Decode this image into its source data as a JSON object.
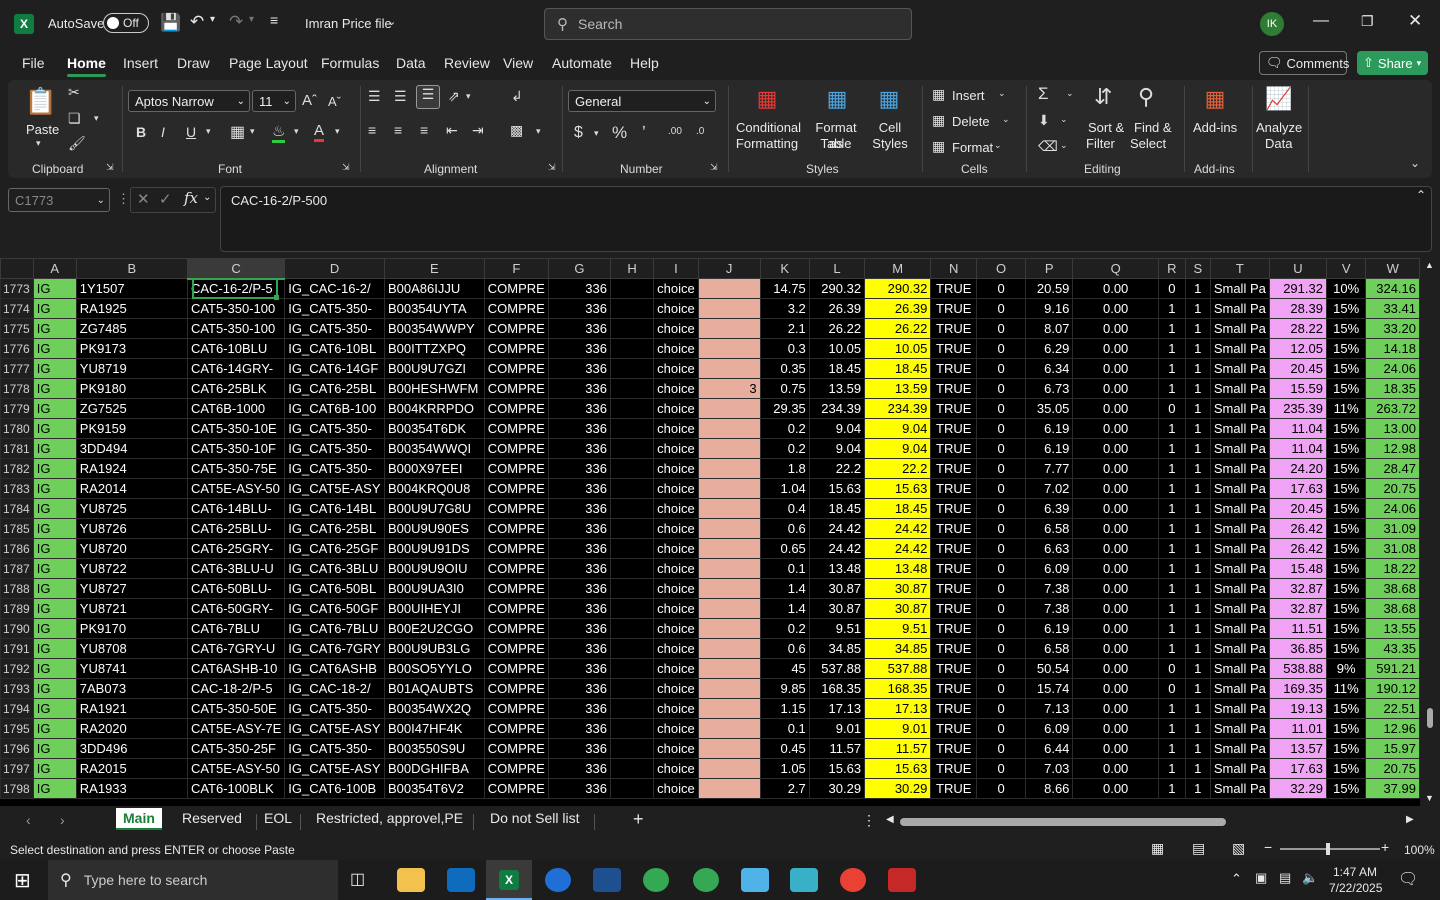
{
  "titlebar": {
    "autosave_label": "AutoSave",
    "autosave_state": "Off",
    "file_name": "Imran Price file",
    "search_placeholder": "Search",
    "avatar_initials": "IK"
  },
  "tabs": [
    "File",
    "Home",
    "Insert",
    "Draw",
    "Page Layout",
    "Formulas",
    "Data",
    "Review",
    "View",
    "Automate",
    "Help"
  ],
  "active_tab": "Home",
  "comments_label": "Comments",
  "share_label": "Share",
  "ribbon": {
    "clipboard": {
      "paste": "Paste",
      "group": "Clipboard"
    },
    "font": {
      "name": "Aptos Narrow",
      "size": "11",
      "group": "Font"
    },
    "alignment": {
      "group": "Alignment"
    },
    "number": {
      "format": "General",
      "group": "Number"
    },
    "styles": {
      "conditional": "Conditional",
      "formatting": "Formatting",
      "format_as": "Format as",
      "table": "Table",
      "cell": "Cell",
      "cell_styles": "Styles",
      "group": "Styles"
    },
    "cells": {
      "insert": "Insert",
      "delete": "Delete",
      "format": "Format",
      "group": "Cells"
    },
    "editing": {
      "sort": "Sort &",
      "filter": "Filter",
      "find": "Find &",
      "select": "Select",
      "group": "Editing"
    },
    "addins": {
      "addins": "Add-ins",
      "group": "Add-ins"
    },
    "analyze": {
      "line1": "Analyze",
      "line2": "Data"
    }
  },
  "formula_bar": {
    "name_box": "C1773",
    "formula": "CAC-16-2/P-500"
  },
  "columns": [
    "A",
    "B",
    "C",
    "D",
    "E",
    "F",
    "G",
    "H",
    "I",
    "J",
    "K",
    "L",
    "M",
    "N",
    "O",
    "P",
    "Q",
    "R",
    "S",
    "T",
    "U",
    "V",
    "W"
  ],
  "rows": [
    {
      "n": "1773",
      "a": "IG",
      "b": "1Y1507",
      "c": "CAC-16-2/P-5",
      "d": "IG_CAC-16-2/",
      "e": "B00A86IJJU",
      "f": "COMPRE",
      "g": "336",
      "i": "choice",
      "j": "",
      "k": "14.75",
      "l": "290.32",
      "m": "290.32",
      "o": "0",
      "p": "20.59",
      "q": "0.00",
      "r": "0",
      "s": "1",
      "t": "Small Pa",
      "u": "291.32",
      "v": "10%",
      "w": "324.16"
    },
    {
      "n": "1774",
      "a": "IG",
      "b": "RA1925",
      "c": "CAT5-350-100",
      "d": "IG_CAT5-350-",
      "e": "B00354UYTA",
      "f": "COMPRE",
      "g": "336",
      "i": "choice",
      "j": "",
      "k": "3.2",
      "l": "26.39",
      "m": "26.39",
      "o": "0",
      "p": "9.16",
      "q": "0.00",
      "r": "1",
      "s": "1",
      "t": "Small Pa",
      "u": "28.39",
      "v": "15%",
      "w": "33.41"
    },
    {
      "n": "1775",
      "a": "IG",
      "b": "ZG7485",
      "c": "CAT5-350-100",
      "d": "IG_CAT5-350-",
      "e": "B00354WWPY",
      "f": "COMPRE",
      "g": "336",
      "i": "choice",
      "j": "",
      "k": "2.1",
      "l": "26.22",
      "m": "26.22",
      "o": "0",
      "p": "8.07",
      "q": "0.00",
      "r": "1",
      "s": "1",
      "t": "Small Pa",
      "u": "28.22",
      "v": "15%",
      "w": "33.20"
    },
    {
      "n": "1776",
      "a": "IG",
      "b": "PK9173",
      "c": "CAT6-10BLU",
      "d": "IG_CAT6-10BL",
      "e": "B00ITTZXPQ",
      "f": "COMPRE",
      "g": "336",
      "i": "choice",
      "j": "",
      "k": "0.3",
      "l": "10.05",
      "m": "10.05",
      "o": "0",
      "p": "6.29",
      "q": "0.00",
      "r": "1",
      "s": "1",
      "t": "Small Pa",
      "u": "12.05",
      "v": "15%",
      "w": "14.18"
    },
    {
      "n": "1777",
      "a": "IG",
      "b": "YU8719",
      "c": "CAT6-14GRY-",
      "d": "IG_CAT6-14GF",
      "e": "B00U9U7GZI",
      "f": "COMPRE",
      "g": "336",
      "i": "choice",
      "j": "",
      "k": "0.35",
      "l": "18.45",
      "m": "18.45",
      "o": "0",
      "p": "6.34",
      "q": "0.00",
      "r": "1",
      "s": "1",
      "t": "Small Pa",
      "u": "20.45",
      "v": "15%",
      "w": "24.06"
    },
    {
      "n": "1778",
      "a": "IG",
      "b": "PK9180",
      "c": "CAT6-25BLK",
      "d": "IG_CAT6-25BL",
      "e": "B00HESHWFM",
      "f": "COMPRE",
      "g": "336",
      "i": "choice",
      "j": "3",
      "k": "0.75",
      "l": "13.59",
      "m": "13.59",
      "o": "0",
      "p": "6.73",
      "q": "0.00",
      "r": "1",
      "s": "1",
      "t": "Small Pa",
      "u": "15.59",
      "v": "15%",
      "w": "18.35"
    },
    {
      "n": "1779",
      "a": "IG",
      "b": "ZG7525",
      "c": "CAT6B-1000",
      "d": "IG_CAT6B-100",
      "e": "B004KRRPDO",
      "f": "COMPRE",
      "g": "336",
      "i": "choice",
      "j": "",
      "k": "29.35",
      "l": "234.39",
      "m": "234.39",
      "o": "0",
      "p": "35.05",
      "q": "0.00",
      "r": "0",
      "s": "1",
      "t": "Small Pa",
      "u": "235.39",
      "v": "11%",
      "w": "263.72"
    },
    {
      "n": "1780",
      "a": "IG",
      "b": "PK9159",
      "c": "CAT5-350-10E",
      "d": "IG_CAT5-350-",
      "e": "B00354T6DK",
      "f": "COMPRE",
      "g": "336",
      "i": "choice",
      "j": "",
      "k": "0.2",
      "l": "9.04",
      "m": "9.04",
      "o": "0",
      "p": "6.19",
      "q": "0.00",
      "r": "1",
      "s": "1",
      "t": "Small Pa",
      "u": "11.04",
      "v": "15%",
      "w": "13.00"
    },
    {
      "n": "1781",
      "a": "IG",
      "b": "3DD494",
      "c": "CAT5-350-10F",
      "d": "IG_CAT5-350-",
      "e": "B00354WWQI",
      "f": "COMPRE",
      "g": "336",
      "i": "choice",
      "j": "",
      "k": "0.2",
      "l": "9.04",
      "m": "9.04",
      "o": "0",
      "p": "6.19",
      "q": "0.00",
      "r": "1",
      "s": "1",
      "t": "Small Pa",
      "u": "11.04",
      "v": "15%",
      "w": "12.98"
    },
    {
      "n": "1782",
      "a": "IG",
      "b": "RA1924",
      "c": "CAT5-350-75E",
      "d": "IG_CAT5-350-",
      "e": "B000X97EEI",
      "f": "COMPRE",
      "g": "336",
      "i": "choice",
      "j": "",
      "k": "1.8",
      "l": "22.2",
      "m": "22.2",
      "o": "0",
      "p": "7.77",
      "q": "0.00",
      "r": "1",
      "s": "1",
      "t": "Small Pa",
      "u": "24.20",
      "v": "15%",
      "w": "28.47"
    },
    {
      "n": "1783",
      "a": "IG",
      "b": "RA2014",
      "c": "CAT5E-ASY-50",
      "d": "IG_CAT5E-ASY",
      "e": "B004KRQ0U8",
      "f": "COMPRE",
      "g": "336",
      "i": "choice",
      "j": "",
      "k": "1.04",
      "l": "15.63",
      "m": "15.63",
      "o": "0",
      "p": "7.02",
      "q": "0.00",
      "r": "1",
      "s": "1",
      "t": "Small Pa",
      "u": "17.63",
      "v": "15%",
      "w": "20.75"
    },
    {
      "n": "1784",
      "a": "IG",
      "b": "YU8725",
      "c": "CAT6-14BLU-",
      "d": "IG_CAT6-14BL",
      "e": "B00U9U7G8U",
      "f": "COMPRE",
      "g": "336",
      "i": "choice",
      "j": "",
      "k": "0.4",
      "l": "18.45",
      "m": "18.45",
      "o": "0",
      "p": "6.39",
      "q": "0.00",
      "r": "1",
      "s": "1",
      "t": "Small Pa",
      "u": "20.45",
      "v": "15%",
      "w": "24.06"
    },
    {
      "n": "1785",
      "a": "IG",
      "b": "YU8726",
      "c": "CAT6-25BLU-",
      "d": "IG_CAT6-25BL",
      "e": "B00U9U90ES",
      "f": "COMPRE",
      "g": "336",
      "i": "choice",
      "j": "",
      "k": "0.6",
      "l": "24.42",
      "m": "24.42",
      "o": "0",
      "p": "6.58",
      "q": "0.00",
      "r": "1",
      "s": "1",
      "t": "Small Pa",
      "u": "26.42",
      "v": "15%",
      "w": "31.09"
    },
    {
      "n": "1786",
      "a": "IG",
      "b": "YU8720",
      "c": "CAT6-25GRY-",
      "d": "IG_CAT6-25GF",
      "e": "B00U9U91DS",
      "f": "COMPRE",
      "g": "336",
      "i": "choice",
      "j": "",
      "k": "0.65",
      "l": "24.42",
      "m": "24.42",
      "o": "0",
      "p": "6.63",
      "q": "0.00",
      "r": "1",
      "s": "1",
      "t": "Small Pa",
      "u": "26.42",
      "v": "15%",
      "w": "31.08"
    },
    {
      "n": "1787",
      "a": "IG",
      "b": "YU8722",
      "c": "CAT6-3BLU-U",
      "d": "IG_CAT6-3BLU",
      "e": "B00U9U9OIU",
      "f": "COMPRE",
      "g": "336",
      "i": "choice",
      "j": "",
      "k": "0.1",
      "l": "13.48",
      "m": "13.48",
      "o": "0",
      "p": "6.09",
      "q": "0.00",
      "r": "1",
      "s": "1",
      "t": "Small Pa",
      "u": "15.48",
      "v": "15%",
      "w": "18.22"
    },
    {
      "n": "1788",
      "a": "IG",
      "b": "YU8727",
      "c": "CAT6-50BLU-",
      "d": "IG_CAT6-50BL",
      "e": "B00U9UA3I0",
      "f": "COMPRE",
      "g": "336",
      "i": "choice",
      "j": "",
      "k": "1.4",
      "l": "30.87",
      "m": "30.87",
      "o": "0",
      "p": "7.38",
      "q": "0.00",
      "r": "1",
      "s": "1",
      "t": "Small Pa",
      "u": "32.87",
      "v": "15%",
      "w": "38.68"
    },
    {
      "n": "1789",
      "a": "IG",
      "b": "YU8721",
      "c": "CAT6-50GRY-",
      "d": "IG_CAT6-50GF",
      "e": "B00UIHEYJI",
      "f": "COMPRE",
      "g": "336",
      "i": "choice",
      "j": "",
      "k": "1.4",
      "l": "30.87",
      "m": "30.87",
      "o": "0",
      "p": "7.38",
      "q": "0.00",
      "r": "1",
      "s": "1",
      "t": "Small Pa",
      "u": "32.87",
      "v": "15%",
      "w": "38.68"
    },
    {
      "n": "1790",
      "a": "IG",
      "b": "PK9170",
      "c": "CAT6-7BLU",
      "d": "IG_CAT6-7BLU",
      "e": "B00E2U2CGO",
      "f": "COMPRE",
      "g": "336",
      "i": "choice",
      "j": "",
      "k": "0.2",
      "l": "9.51",
      "m": "9.51",
      "o": "0",
      "p": "6.19",
      "q": "0.00",
      "r": "1",
      "s": "1",
      "t": "Small Pa",
      "u": "11.51",
      "v": "15%",
      "w": "13.55"
    },
    {
      "n": "1791",
      "a": "IG",
      "b": "YU8708",
      "c": "CAT6-7GRY-U",
      "d": "IG_CAT6-7GRY",
      "e": "B00U9UB3LG",
      "f": "COMPRE",
      "g": "336",
      "i": "choice",
      "j": "",
      "k": "0.6",
      "l": "34.85",
      "m": "34.85",
      "o": "0",
      "p": "6.58",
      "q": "0.00",
      "r": "1",
      "s": "1",
      "t": "Small Pa",
      "u": "36.85",
      "v": "15%",
      "w": "43.35"
    },
    {
      "n": "1792",
      "a": "IG",
      "b": "YU8741",
      "c": "CAT6ASHB-10",
      "d": "IG_CAT6ASHB",
      "e": "B00SO5YYLO",
      "f": "COMPRE",
      "g": "336",
      "i": "choice",
      "j": "",
      "k": "45",
      "l": "537.88",
      "m": "537.88",
      "o": "0",
      "p": "50.54",
      "q": "0.00",
      "r": "0",
      "s": "1",
      "t": "Small Pa",
      "u": "538.88",
      "v": "9%",
      "w": "591.21"
    },
    {
      "n": "1793",
      "a": "IG",
      "b": "7AB073",
      "c": "CAC-18-2/P-5",
      "d": "IG_CAC-18-2/",
      "e": "B01AQAUBTS",
      "f": "COMPRE",
      "g": "336",
      "i": "choice",
      "j": "",
      "k": "9.85",
      "l": "168.35",
      "m": "168.35",
      "o": "0",
      "p": "15.74",
      "q": "0.00",
      "r": "0",
      "s": "1",
      "t": "Small Pa",
      "u": "169.35",
      "v": "11%",
      "w": "190.12"
    },
    {
      "n": "1794",
      "a": "IG",
      "b": "RA1921",
      "c": "CAT5-350-50E",
      "d": "IG_CAT5-350-",
      "e": "B00354WX2Q",
      "f": "COMPRE",
      "g": "336",
      "i": "choice",
      "j": "",
      "k": "1.15",
      "l": "17.13",
      "m": "17.13",
      "o": "0",
      "p": "7.13",
      "q": "0.00",
      "r": "1",
      "s": "1",
      "t": "Small Pa",
      "u": "19.13",
      "v": "15%",
      "w": "22.51"
    },
    {
      "n": "1795",
      "a": "IG",
      "b": "RA2020",
      "c": "CAT5E-ASY-7E",
      "d": "IG_CAT5E-ASY",
      "e": "B00I47HF4K",
      "f": "COMPRE",
      "g": "336",
      "i": "choice",
      "j": "",
      "k": "0.1",
      "l": "9.01",
      "m": "9.01",
      "o": "0",
      "p": "6.09",
      "q": "0.00",
      "r": "1",
      "s": "1",
      "t": "Small Pa",
      "u": "11.01",
      "v": "15%",
      "w": "12.96"
    },
    {
      "n": "1796",
      "a": "IG",
      "b": "3DD496",
      "c": "CAT5-350-25F",
      "d": "IG_CAT5-350-",
      "e": "B003550S9U",
      "f": "COMPRE",
      "g": "336",
      "i": "choice",
      "j": "",
      "k": "0.45",
      "l": "11.57",
      "m": "11.57",
      "o": "0",
      "p": "6.44",
      "q": "0.00",
      "r": "1",
      "s": "1",
      "t": "Small Pa",
      "u": "13.57",
      "v": "15%",
      "w": "15.97"
    },
    {
      "n": "1797",
      "a": "IG",
      "b": "RA2015",
      "c": "CAT5E-ASY-50",
      "d": "IG_CAT5E-ASY",
      "e": "B00DGHIFBA",
      "f": "COMPRE",
      "g": "336",
      "i": "choice",
      "j": "",
      "k": "1.05",
      "l": "15.63",
      "m": "15.63",
      "o": "0",
      "p": "7.03",
      "q": "0.00",
      "r": "1",
      "s": "1",
      "t": "Small Pa",
      "u": "17.63",
      "v": "15%",
      "w": "20.75"
    },
    {
      "n": "1798",
      "a": "IG",
      "b": "RA1933",
      "c": "CAT6-100BLK",
      "d": "IG_CAT6-100B",
      "e": "B00354T6V2",
      "f": "COMPRE",
      "g": "336",
      "i": "choice",
      "j": "",
      "k": "2.7",
      "l": "30.29",
      "m": "30.29",
      "o": "0",
      "p": "8.66",
      "q": "0.00",
      "r": "1",
      "s": "1",
      "t": "Small Pa",
      "u": "32.29",
      "v": "15%",
      "w": "37.99"
    }
  ],
  "bool_value": "TRUE",
  "sheets": [
    "Main",
    "Reserved",
    "EOL",
    "Restricted, approvel,PE",
    "Do not Sell list"
  ],
  "active_sheet": "Main",
  "status": {
    "message": "Select destination and press ENTER or choose Paste",
    "zoom": "100%"
  },
  "taskbar": {
    "search_placeholder": "Type here to search",
    "time": "1:47 AM",
    "date": "7/22/2025"
  },
  "colors": {
    "excel_green": "#107c41",
    "highlight_yellow": "#ffff00",
    "green_fill": "#6fcf5b",
    "salmon_fill": "#e8ae9d",
    "pink_fill": "#f0a3f5"
  }
}
